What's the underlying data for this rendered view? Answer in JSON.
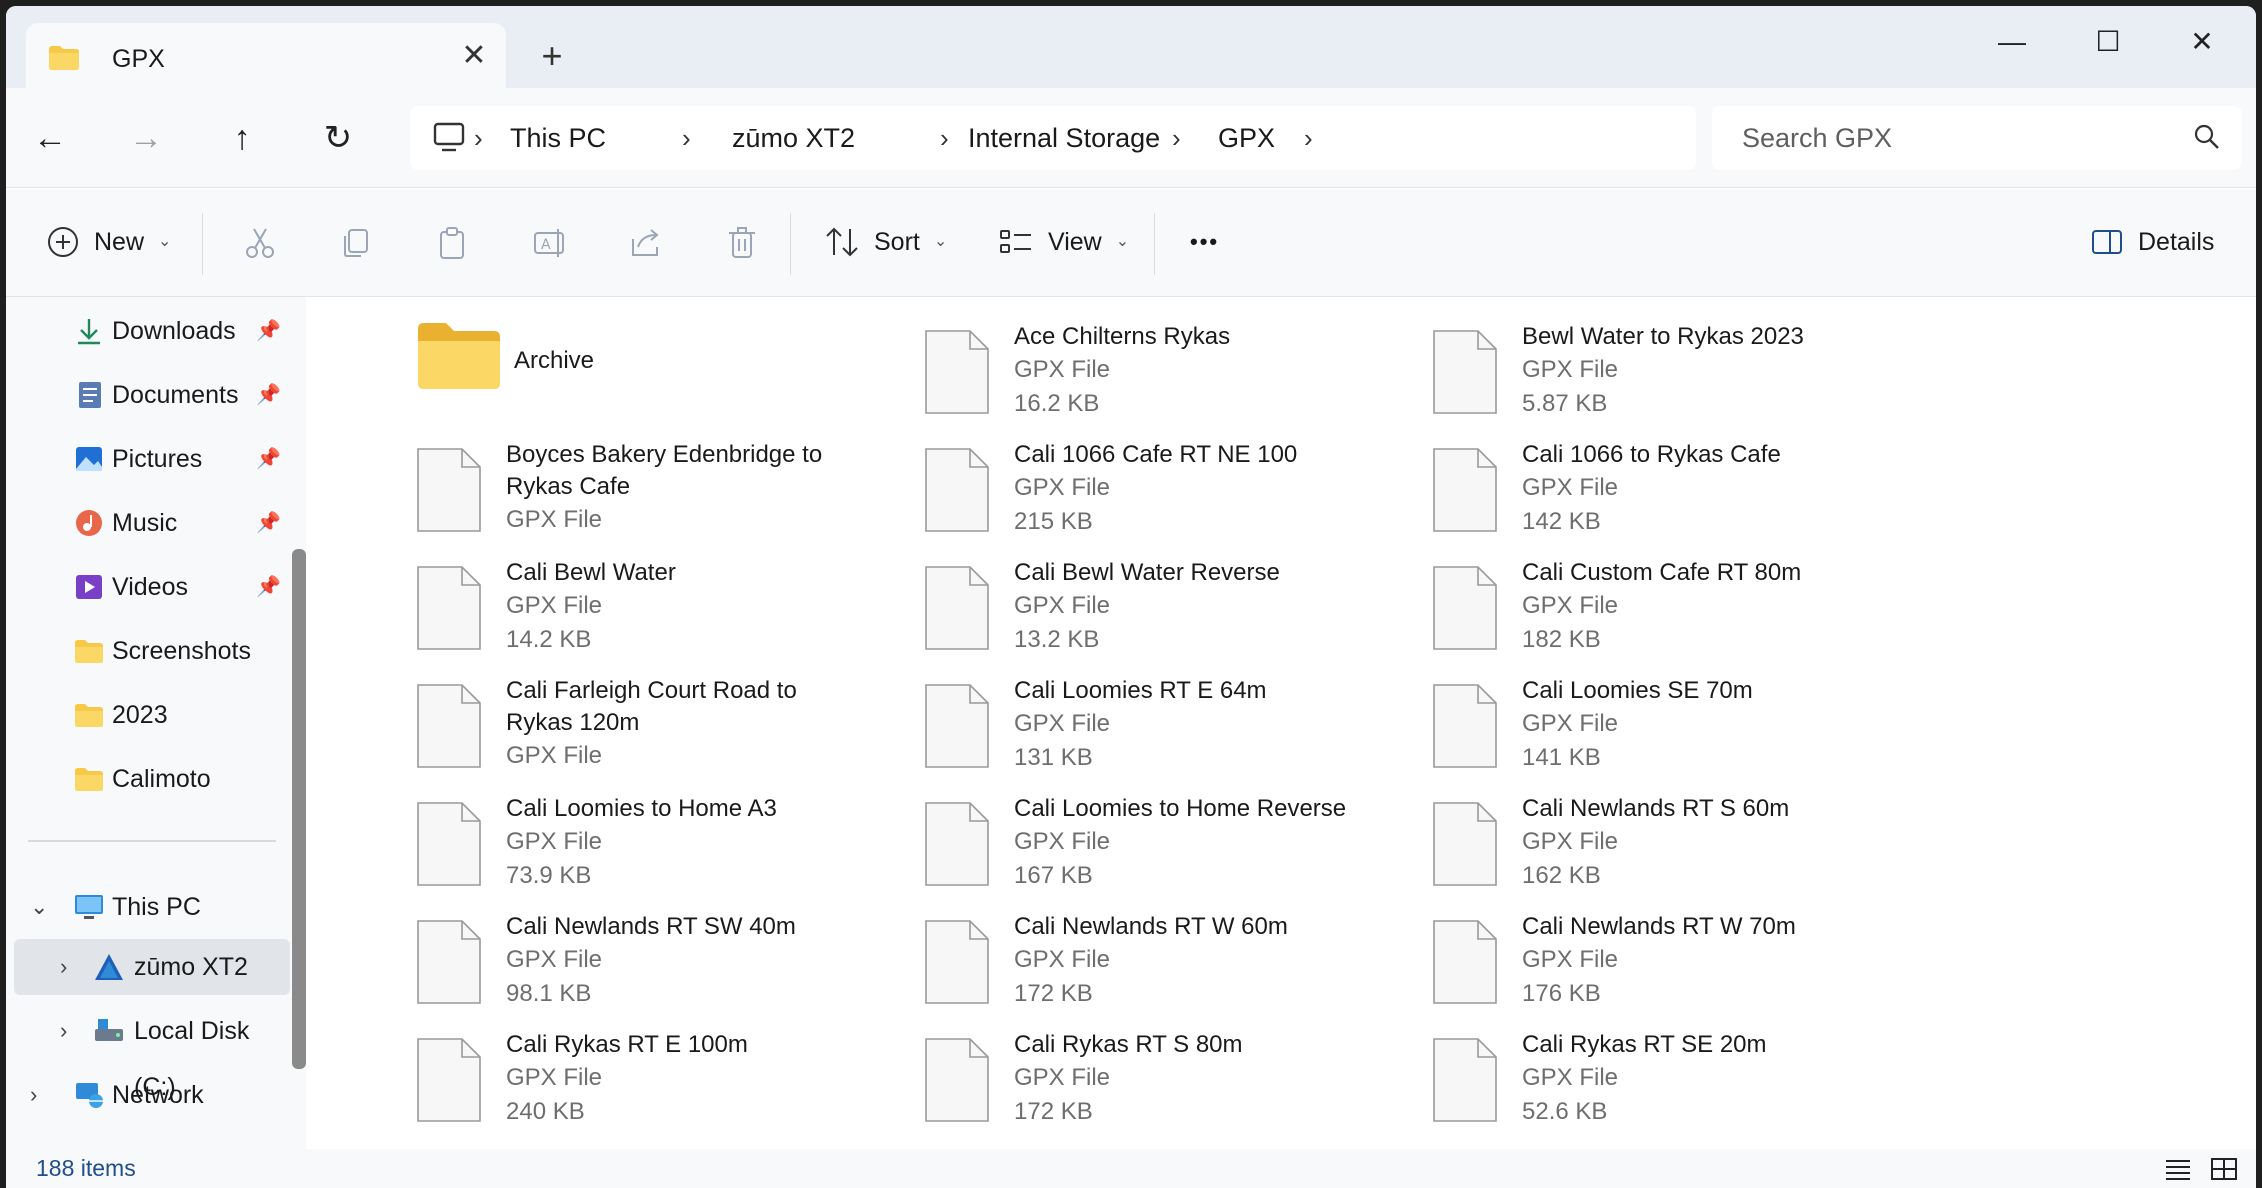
{
  "window": {
    "tab_title": "GPX",
    "close_tab": "✕",
    "new_tab": "+",
    "minimize": "—",
    "maximize": "☐",
    "close": "✕"
  },
  "nav": {
    "back": "←",
    "forward": "→",
    "up": "↑",
    "refresh": "↻"
  },
  "breadcrumb": [
    "This PC",
    "zūmo XT2",
    "Internal Storage",
    "GPX"
  ],
  "search": {
    "placeholder": "Search GPX"
  },
  "toolbar": {
    "new_label": "New",
    "sort_label": "Sort",
    "view_label": "View",
    "more_label": "•••",
    "details_label": "Details"
  },
  "sidebar": {
    "quick_access": [
      {
        "label": "Downloads",
        "icon": "download-icon"
      },
      {
        "label": "Documents",
        "icon": "documents-icon"
      },
      {
        "label": "Pictures",
        "icon": "pictures-icon"
      },
      {
        "label": "Music",
        "icon": "music-icon"
      },
      {
        "label": "Videos",
        "icon": "videos-icon"
      },
      {
        "label": "Screenshots",
        "icon": "folder-icon"
      },
      {
        "label": "2023",
        "icon": "folder-icon"
      },
      {
        "label": "Calimoto",
        "icon": "folder-icon"
      }
    ],
    "tree": [
      {
        "label": "This PC",
        "icon": "monitor-icon",
        "expander": "⌄"
      },
      {
        "label": "zūmo XT2",
        "icon": "garmin-icon",
        "expander": "›"
      },
      {
        "label": "Local Disk (C:)",
        "icon": "disk-icon",
        "expander": "›"
      },
      {
        "label": "Network",
        "icon": "network-icon",
        "expander": "›"
      }
    ]
  },
  "files": {
    "folder": {
      "name": "Archive"
    },
    "items": [
      {
        "name": "Ace Chilterns Rykas",
        "type": "GPX File",
        "size": "16.2 KB"
      },
      {
        "name": "Bewl Water to Rykas 2023",
        "type": "GPX File",
        "size": "5.87 KB"
      },
      {
        "name": "Boyces Bakery Edenbridge to Rykas Cafe",
        "type": "GPX File",
        "size": ""
      },
      {
        "name": "Cali 1066 Cafe RT NE 100",
        "type": "GPX File",
        "size": "215 KB"
      },
      {
        "name": "Cali 1066 to Rykas Cafe",
        "type": "GPX File",
        "size": "142 KB"
      },
      {
        "name": "Cali Bewl Water",
        "type": "GPX File",
        "size": "14.2 KB"
      },
      {
        "name": "Cali Bewl Water Reverse",
        "type": "GPX File",
        "size": "13.2 KB"
      },
      {
        "name": "Cali Custom Cafe RT 80m",
        "type": "GPX File",
        "size": "182 KB"
      },
      {
        "name": "Cali Farleigh Court Road to Rykas 120m",
        "type": "GPX File",
        "size": ""
      },
      {
        "name": "Cali Loomies RT E 64m",
        "type": "GPX File",
        "size": "131 KB"
      },
      {
        "name": "Cali Loomies SE 70m",
        "type": "GPX File",
        "size": "141 KB"
      },
      {
        "name": "Cali Loomies to Home A3",
        "type": "GPX File",
        "size": "73.9 KB"
      },
      {
        "name": "Cali Loomies to Home Reverse",
        "type": "GPX File",
        "size": "167 KB"
      },
      {
        "name": "Cali Newlands RT S 60m",
        "type": "GPX File",
        "size": "162 KB"
      },
      {
        "name": "Cali Newlands RT SW 40m",
        "type": "GPX File",
        "size": "98.1 KB"
      },
      {
        "name": "Cali Newlands RT W 60m",
        "type": "GPX File",
        "size": "172 KB"
      },
      {
        "name": "Cali Newlands RT W 70m",
        "type": "GPX File",
        "size": "176 KB"
      },
      {
        "name": "Cali Rykas RT E 100m",
        "type": "GPX File",
        "size": "240 KB"
      },
      {
        "name": "Cali Rykas RT S 80m",
        "type": "GPX File",
        "size": "172 KB"
      },
      {
        "name": "Cali Rykas RT SE 20m",
        "type": "GPX File",
        "size": "52.6 KB"
      }
    ]
  },
  "status": {
    "item_count": "188 items"
  },
  "colors": {
    "folder": "#f7c948",
    "accent": "#1f4e8c",
    "titlebar": "#e9eef5"
  }
}
